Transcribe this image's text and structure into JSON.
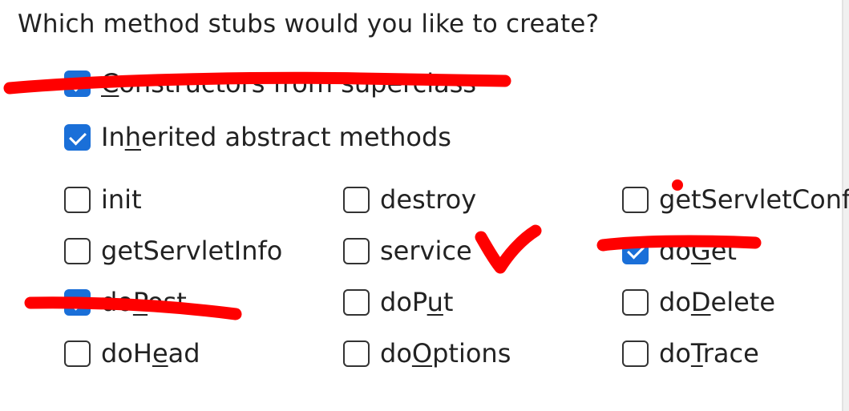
{
  "prompt": "Which method stubs would you like to create?",
  "options": {
    "constructors": {
      "label": "Constructors from superclass",
      "checked": true
    },
    "inherited": {
      "label": "Inherited abstract methods",
      "checked": true
    },
    "init": {
      "label": "init",
      "checked": false
    },
    "destroy": {
      "label": "destroy",
      "checked": false
    },
    "getServletConfig": {
      "label": "getServletConfig",
      "checked": false
    },
    "getServletInfo": {
      "label": "getServletInfo",
      "checked": false
    },
    "service": {
      "label": "service",
      "checked": false
    },
    "doGet": {
      "label": "doGet",
      "checked": true
    },
    "doPost": {
      "label": "doPost",
      "checked": true
    },
    "doPut": {
      "label": "doPut",
      "checked": false
    },
    "doDelete": {
      "label": "doDelete",
      "checked": false
    },
    "doHead": {
      "label": "doHead",
      "checked": false
    },
    "doOptions": {
      "label": "doOptions",
      "checked": false
    },
    "doTrace": {
      "label": "doTrace",
      "checked": false
    }
  },
  "annotation_color": "#ff0000",
  "accent_color": "#1a6fd8"
}
